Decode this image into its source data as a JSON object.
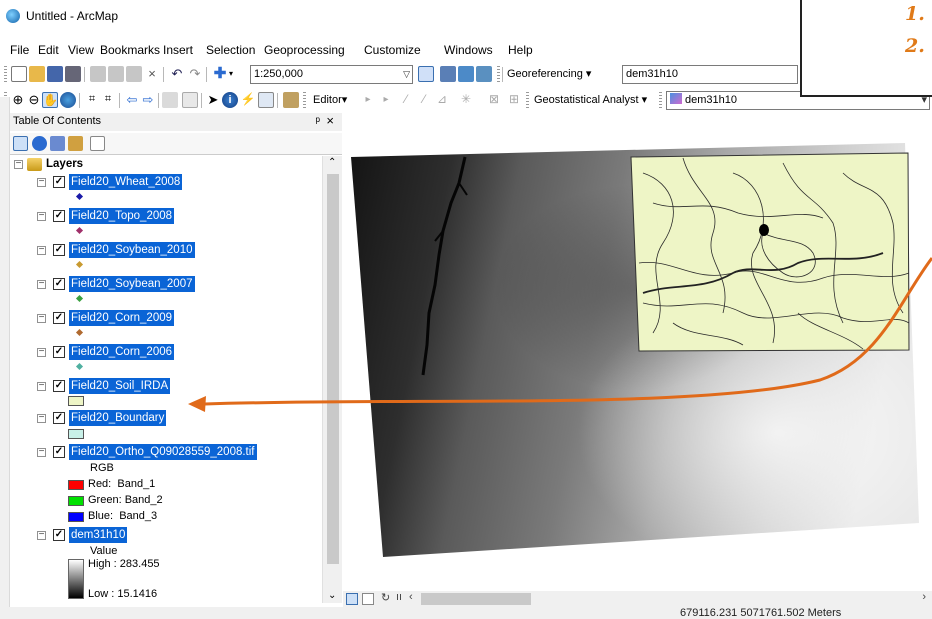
{
  "window": {
    "title": "Untitled - ArcMap"
  },
  "menu": [
    "File",
    "Edit",
    "View",
    "Bookmarks",
    "Insert",
    "Selection",
    "Geoprocessing",
    "Customize",
    "Windows",
    "Help"
  ],
  "toolbar": {
    "scale_value": "1:250,000",
    "georeferencing_label": "Georeferencing",
    "georef_layer": "dem31h10",
    "editor_label": "Editor",
    "geostat_label": "Geostatistical Analyst",
    "layer_combo": "dem31h10"
  },
  "notes": [
    "1.",
    "2."
  ],
  "toc": {
    "title": "Table Of Contents",
    "pin": "ᵖ",
    "close": "×",
    "root": "Layers",
    "layers": [
      {
        "name": "Field20_Wheat_2008",
        "symbol": "dot",
        "color": "#1a1aa8"
      },
      {
        "name": "Field20_Topo_2008",
        "symbol": "dot",
        "color": "#a0306a"
      },
      {
        "name": "Field20_Soybean_2010",
        "symbol": "dot",
        "color": "#c89a30"
      },
      {
        "name": "Field20_Soybean_2007",
        "symbol": "dot",
        "color": "#3aa040"
      },
      {
        "name": "Field20_Corn_2009",
        "symbol": "dot",
        "color": "#b06a30"
      },
      {
        "name": "Field20_Corn_2006",
        "symbol": "dot",
        "color": "#50b0a0"
      },
      {
        "name": "Field20_Soil_IRDA",
        "symbol": "swatch",
        "color": "#eef5c6"
      },
      {
        "name": "Field20_Boundary",
        "symbol": "swatch",
        "color": "#c8f0e8"
      }
    ],
    "ortho": {
      "name": "Field20_Ortho_Q09028559_2008.tif",
      "rgb_label": "RGB",
      "bands": [
        {
          "label": "Red:",
          "band": "Band_1",
          "color": "#ff0000"
        },
        {
          "label": "Green:",
          "band": "Band_2",
          "color": "#00e000"
        },
        {
          "label": "Blue:",
          "band": "Band_3",
          "color": "#0000ff"
        }
      ]
    },
    "dem": {
      "name": "dem31h10",
      "value_label": "Value",
      "high": "High : 283.455",
      "low": "Low : 15.1416"
    }
  },
  "status": {
    "coords": "679116.231  5071761.502 Meters"
  },
  "colors": {
    "selection": "#0a64d6",
    "arrow": "#e06a1a",
    "soil_fill": "#eef5c6"
  }
}
